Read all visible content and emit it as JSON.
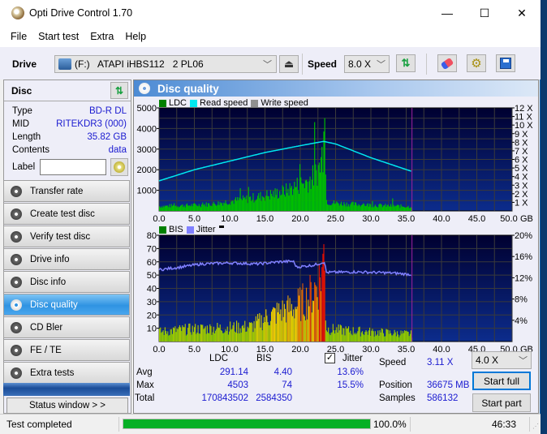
{
  "window": {
    "title": "Opti Drive Control 1.70",
    "minimize": "—",
    "maximize": "☐",
    "close": "✕"
  },
  "menu": [
    "File",
    "Start test",
    "Extra",
    "Help"
  ],
  "toolbar": {
    "drive_label": "Drive",
    "drive_value": "(F:)   ATAPI iHBS112   2 PL06",
    "speed_label": "Speed",
    "speed_value": "8.0 X",
    "icons": [
      "eject-icon",
      "refresh-icon",
      "erase-icon",
      "settings-icon",
      "save-icon"
    ]
  },
  "disc": {
    "header": "Disc",
    "rows": [
      {
        "k": "Type",
        "v": "BD-R DL"
      },
      {
        "k": "MID",
        "v": "RITEKDR3 (000)"
      },
      {
        "k": "Length",
        "v": "35.82 GB"
      },
      {
        "k": "Contents",
        "v": "data"
      }
    ],
    "label_label": "Label",
    "label_value": ""
  },
  "nav": [
    {
      "label": "Transfer rate",
      "active": false
    },
    {
      "label": "Create test disc",
      "active": false
    },
    {
      "label": "Verify test disc",
      "active": false
    },
    {
      "label": "Drive info",
      "active": false
    },
    {
      "label": "Disc info",
      "active": false
    },
    {
      "label": "Disc quality",
      "active": true
    },
    {
      "label": "CD Bler",
      "active": false
    },
    {
      "label": "FE / TE",
      "active": false
    },
    {
      "label": "Extra tests",
      "active": false
    }
  ],
  "status_window_btn": "Status window > >",
  "panel": {
    "title": "Disc quality"
  },
  "colors": {
    "ldc": "#00c000",
    "read_speed": "#00e8f0",
    "write_speed": "#909090",
    "jitter": "#8080ff",
    "plot_bg_top": "#000030",
    "plot_bg_bottom": "#0c2c8c",
    "end_marker": "#a020a0",
    "progress": "#06b025"
  },
  "chart_data": [
    {
      "type": "bar",
      "title": "LDC",
      "legend": [
        "LDC",
        "Read speed",
        "Write speed"
      ],
      "xlabel": "GB",
      "x_ticks": [
        "0.0",
        "5.0",
        "10.0",
        "15.0",
        "20.0",
        "25.0",
        "30.0",
        "35.0",
        "40.0",
        "45.0",
        "50.0"
      ],
      "xlim": [
        0,
        50
      ],
      "ylim": [
        0,
        5000
      ],
      "y_ticks": [
        "1000",
        "2000",
        "3000",
        "4000",
        "5000"
      ],
      "y2_ticks": [
        "1 X",
        "2 X",
        "3 X",
        "4 X",
        "5 X",
        "6 X",
        "7 X",
        "8 X",
        "9 X",
        "10 X",
        "11 X",
        "12 X"
      ],
      "y2lim": [
        0,
        12
      ],
      "end_marker_gb": 35.82,
      "ldc_profile": [
        [
          0,
          250
        ],
        [
          2,
          280
        ],
        [
          4,
          300
        ],
        [
          6,
          330
        ],
        [
          8,
          400
        ],
        [
          10,
          520
        ],
        [
          12,
          620
        ],
        [
          14,
          760
        ],
        [
          15,
          840
        ],
        [
          16,
          900
        ],
        [
          17,
          1000
        ],
        [
          18,
          1100
        ],
        [
          19,
          1300
        ],
        [
          20,
          1450
        ],
        [
          21,
          1600
        ],
        [
          22,
          1900
        ],
        [
          22.8,
          2500
        ],
        [
          23.2,
          3500
        ],
        [
          23.4,
          4503
        ],
        [
          23.6,
          600
        ],
        [
          24,
          450
        ],
        [
          26,
          400
        ],
        [
          28,
          350
        ],
        [
          30,
          320
        ],
        [
          32,
          280
        ],
        [
          34,
          260
        ],
        [
          35.8,
          230
        ]
      ],
      "read_speed_profile": [
        [
          0,
          3.5
        ],
        [
          5,
          4.8
        ],
        [
          10,
          5.8
        ],
        [
          15,
          6.8
        ],
        [
          20,
          7.6
        ],
        [
          23.3,
          8.1
        ],
        [
          25,
          7.8
        ],
        [
          30,
          6.2
        ],
        [
          35.8,
          4.6
        ]
      ]
    },
    {
      "type": "bar",
      "title": "BIS",
      "legend": [
        "BIS",
        "Jitter"
      ],
      "xlabel": "GB",
      "x_ticks": [
        "0.0",
        "5.0",
        "10.0",
        "15.0",
        "20.0",
        "25.0",
        "30.0",
        "35.0",
        "40.0",
        "45.0",
        "50.0"
      ],
      "xlim": [
        0,
        50
      ],
      "ylim": [
        0,
        80
      ],
      "y_ticks": [
        "10",
        "20",
        "30",
        "40",
        "50",
        "60",
        "70",
        "80"
      ],
      "y2_ticks": [
        "4%",
        "8%",
        "12%",
        "16%",
        "20%"
      ],
      "y2lim": [
        0,
        20
      ],
      "end_marker_gb": 35.82,
      "bis_profile": [
        [
          0,
          9
        ],
        [
          3,
          11
        ],
        [
          6,
          12
        ],
        [
          10,
          13
        ],
        [
          13,
          14
        ],
        [
          15,
          22
        ],
        [
          17,
          28
        ],
        [
          19,
          32
        ],
        [
          21,
          40
        ],
        [
          22.5,
          55
        ],
        [
          23.3,
          74
        ],
        [
          23.6,
          12
        ],
        [
          25,
          11
        ],
        [
          27,
          10
        ],
        [
          30,
          9
        ],
        [
          33,
          8
        ],
        [
          35.8,
          7
        ]
      ],
      "jitter_profile": [
        [
          0,
          13.5
        ],
        [
          3,
          14.0
        ],
        [
          6,
          14.6
        ],
        [
          10,
          14.8
        ],
        [
          14,
          14.6
        ],
        [
          17,
          15.0
        ],
        [
          19,
          15.1
        ],
        [
          19.5,
          14.0
        ],
        [
          22,
          14.4
        ],
        [
          23.4,
          15.0
        ],
        [
          23.7,
          13.0
        ],
        [
          28,
          13.1
        ],
        [
          33,
          12.9
        ],
        [
          35.8,
          12.6
        ]
      ]
    }
  ],
  "stats": {
    "col_ldc": "LDC",
    "col_bis": "BIS",
    "col_jitter": "Jitter",
    "jitter_checked": true,
    "rows": [
      {
        "k": "Avg",
        "ldc": "291.14",
        "bis": "4.40",
        "jitter": "13.6%"
      },
      {
        "k": "Max",
        "ldc": "4503",
        "bis": "74",
        "jitter": "15.5%"
      },
      {
        "k": "Total",
        "ldc": "170843502",
        "bis": "2584350",
        "jitter": ""
      }
    ],
    "speed_label": "Speed",
    "speed_value": "3.11 X",
    "position_label": "Position",
    "position_value": "36675 MB",
    "samples_label": "Samples",
    "samples_value": "586132",
    "test_speed": "4.0 X",
    "start_full": "Start full",
    "start_part": "Start part"
  },
  "statusbar": {
    "text": "Test completed",
    "progress": 100.0,
    "percent": "100.0%",
    "time": "46:33"
  }
}
